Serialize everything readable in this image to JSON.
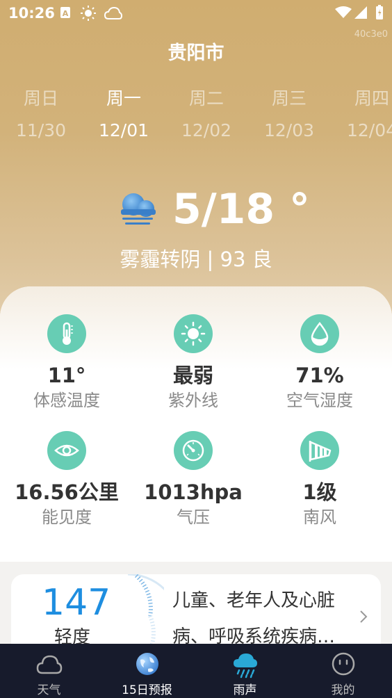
{
  "status_bar": {
    "time": "10:26"
  },
  "watermark": "40c3e0",
  "header": {
    "city": "贵阳市"
  },
  "days": [
    {
      "name": "周日",
      "date": "11/30",
      "active": false
    },
    {
      "name": "周一",
      "date": "12/01",
      "active": true
    },
    {
      "name": "周二",
      "date": "12/02",
      "active": false
    },
    {
      "name": "周三",
      "date": "12/03",
      "active": false
    },
    {
      "name": "周四",
      "date": "12/04",
      "active": false
    }
  ],
  "current": {
    "temp_range": "5/18 °",
    "condition": "雾霾转阴 | 93 良",
    "icon": "fog-cloud-icon"
  },
  "stats": [
    {
      "value": "11°",
      "label": "体感温度",
      "icon": "thermometer-icon"
    },
    {
      "value": "最弱",
      "label": "紫外线",
      "icon": "sun-icon"
    },
    {
      "value": "71%",
      "label": "空气湿度",
      "icon": "water-drop-icon"
    },
    {
      "value": "16.56公里",
      "label": "能见度",
      "icon": "eye-icon"
    },
    {
      "value": "1013hpa",
      "label": "气压",
      "icon": "gauge-icon"
    },
    {
      "value": "1级",
      "label": "南风",
      "icon": "windsock-icon"
    }
  ],
  "aqi": {
    "value": "147",
    "level": "轻度",
    "advice": "儿童、老年人及心脏病、呼吸系统疾病…"
  },
  "nav": [
    {
      "label": "天气",
      "icon": "cloud-icon"
    },
    {
      "label": "15日预报",
      "icon": "globe-icon"
    },
    {
      "label": "雨声",
      "icon": "rain-cloud-icon"
    },
    {
      "label": "我的",
      "icon": "smiley-icon"
    }
  ],
  "colors": {
    "accent": "#67cdb4",
    "aqi_blue": "#1e8ee0",
    "nav_bg": "#171b2c",
    "hero": "#d0ad70"
  }
}
